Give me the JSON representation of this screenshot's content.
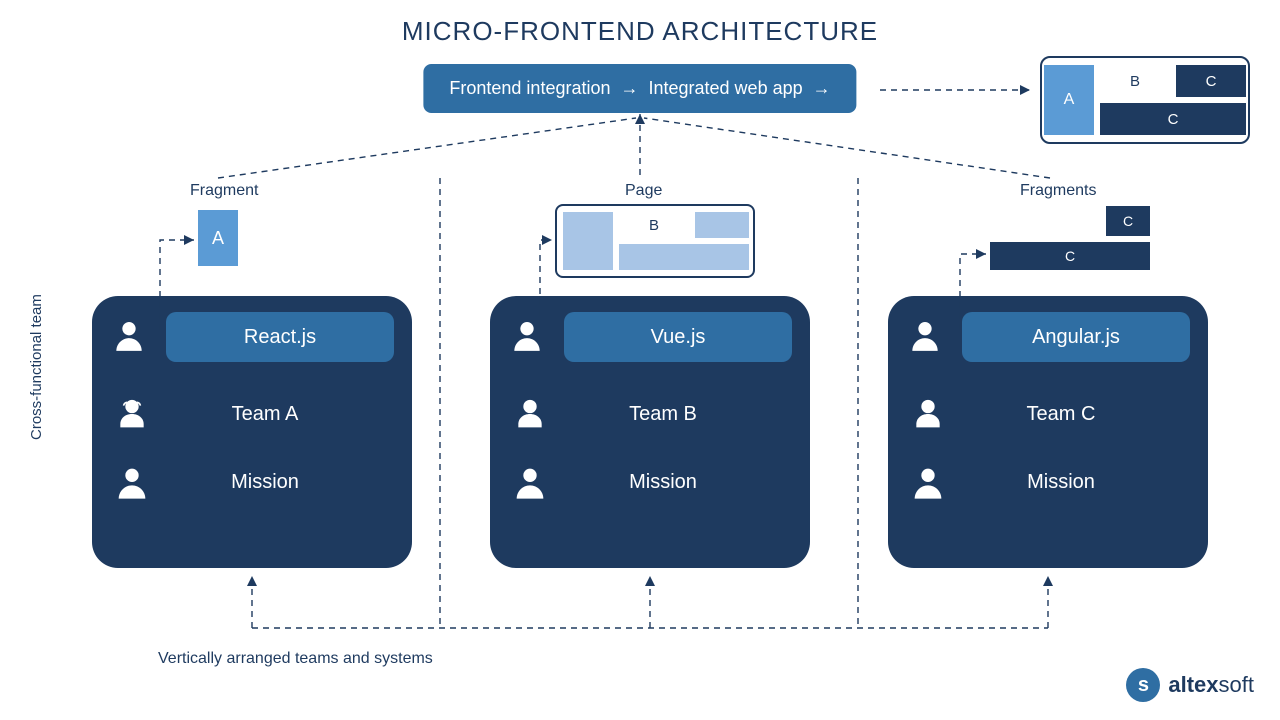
{
  "title": "MICRO-FRONTEND ARCHITECTURE",
  "integration": {
    "part1": "Frontend integration",
    "part2": "Integrated web app"
  },
  "integrated_preview": {
    "a": "A",
    "b": "B",
    "c1": "C",
    "c2": "C"
  },
  "columns": {
    "fragment_label": "Fragment",
    "page_label": "Page",
    "fragments_label": "Fragments",
    "frag_a": "A",
    "page_b": "B",
    "frag_c_small": "C",
    "frag_c_wide": "C"
  },
  "teams": [
    {
      "tech": "React.js",
      "name": "Team A",
      "mission": "Mission"
    },
    {
      "tech": "Vue.js",
      "name": "Team B",
      "mission": "Mission"
    },
    {
      "tech": "Angular.js",
      "name": "Team C",
      "mission": "Mission"
    }
  ],
  "side_label": "Cross-functional team",
  "bottom_label": "Vertically arranged teams and systems",
  "logo": {
    "brand_bold": "altex",
    "brand_rest": "soft"
  }
}
